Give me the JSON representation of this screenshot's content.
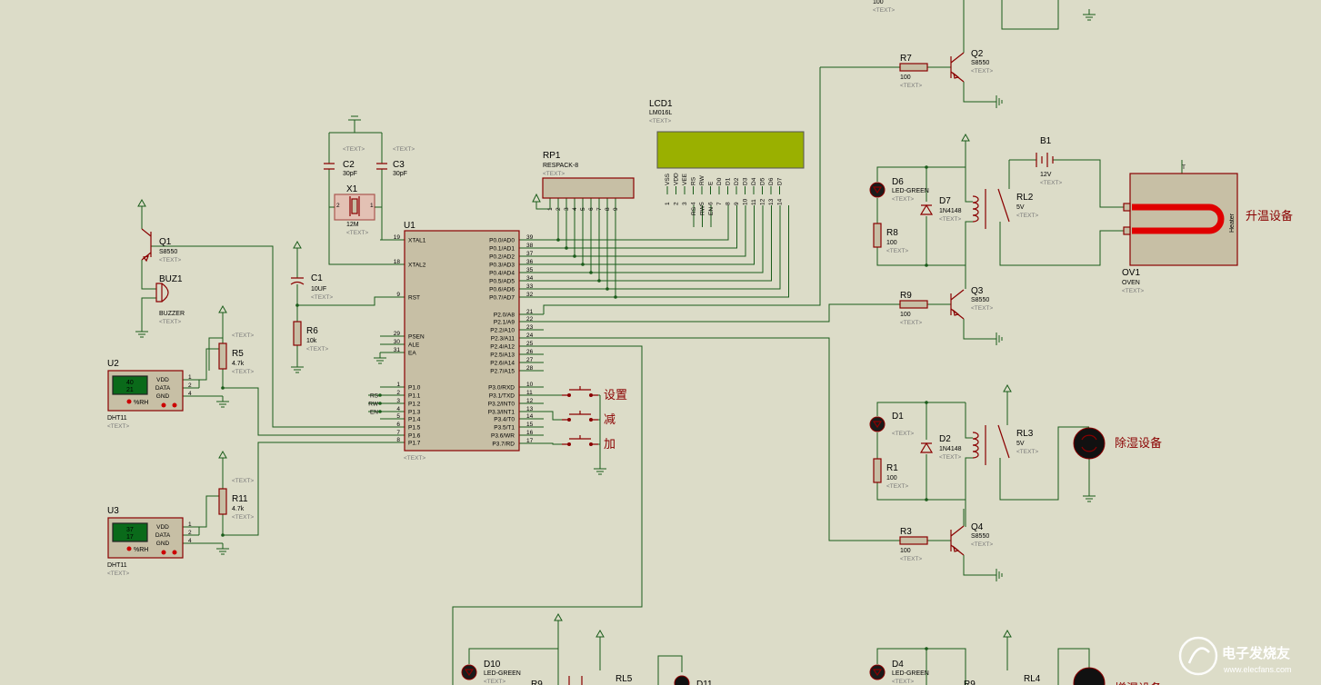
{
  "text_placeholder": "<TEXT>",
  "q1": {
    "ref": "Q1",
    "val": "S8550"
  },
  "buz1": {
    "ref": "BUZ1",
    "val": "BUZZER"
  },
  "q2": {
    "ref": "Q2",
    "val": "S8550"
  },
  "q3": {
    "ref": "Q3",
    "val": "S8550"
  },
  "q4": {
    "ref": "Q4",
    "val": "S8550"
  },
  "r5": {
    "ref": "R5",
    "val": "4.7k"
  },
  "r11": {
    "ref": "R11",
    "val": "4.7k"
  },
  "r6": {
    "ref": "R6",
    "val": "10k"
  },
  "r7": {
    "ref": "R7",
    "val": "100"
  },
  "r9": {
    "ref": "R9",
    "val": "100"
  },
  "r3": {
    "ref": "R3",
    "val": "100"
  },
  "r8": {
    "ref": "R8",
    "val": "100"
  },
  "r1": {
    "ref": "R1",
    "val": "100"
  },
  "r_top": {
    "val": "100"
  },
  "r9b": {
    "ref": "R9"
  },
  "r10b": {
    "ref": "R9"
  },
  "c1": {
    "ref": "C1",
    "val": "10UF"
  },
  "c2": {
    "ref": "C2",
    "val": "30pF"
  },
  "c3": {
    "ref": "C3",
    "val": "30pF"
  },
  "x1": {
    "ref": "X1",
    "val": "12M",
    "pin1": "1",
    "pin2": "2"
  },
  "u1": {
    "ref": "U1"
  },
  "u2": {
    "ref": "U2",
    "val": "DHT11",
    "t": "40",
    "h": "21",
    "unit": "%RH"
  },
  "u3": {
    "ref": "U3",
    "val": "DHT11",
    "t": "37",
    "h": "17",
    "unit": "%RH"
  },
  "dht_pins": {
    "vdd": "VDD",
    "data": "DATA",
    "gnd": "GND",
    "n1": "1",
    "n2": "2",
    "n4": "4"
  },
  "rp1": {
    "ref": "RP1",
    "val": "RESPACK-8",
    "pins": [
      "1",
      "2",
      "3",
      "4",
      "5",
      "6",
      "7",
      "8",
      "9"
    ]
  },
  "lcd": {
    "ref": "LCD1",
    "val": "LM016L",
    "pins": [
      "VSS",
      "VDD",
      "VEE",
      "RS",
      "RW",
      "E",
      "D0",
      "D1",
      "D2",
      "D3",
      "D4",
      "D5",
      "D6",
      "D7"
    ],
    "nums": [
      "1",
      "2",
      "3",
      "4",
      "5",
      "6",
      "7",
      "8",
      "9",
      "10",
      "11",
      "12",
      "13",
      "14"
    ]
  },
  "lcd_sig": [
    "RS",
    "RW",
    "EN"
  ],
  "mcu_left": [
    {
      "n": "19",
      "l": "XTAL1"
    },
    {
      "n": "18",
      "l": "XTAL2"
    },
    {
      "n": "9",
      "l": "RST"
    },
    {
      "n": "29",
      "l": "PSEN"
    },
    {
      "n": "30",
      "l": "ALE"
    },
    {
      "n": "31",
      "l": "EA"
    },
    {
      "n": "1",
      "l": "P1.0"
    },
    {
      "n": "2",
      "l": "P1.1"
    },
    {
      "n": "3",
      "l": "P1.2"
    },
    {
      "n": "4",
      "l": "P1.3"
    },
    {
      "n": "5",
      "l": "P1.4"
    },
    {
      "n": "6",
      "l": "P1.5"
    },
    {
      "n": "7",
      "l": "P1.6"
    },
    {
      "n": "8",
      "l": "P1.7"
    }
  ],
  "mcu_right": [
    {
      "n": "39",
      "l": "P0.0/AD0"
    },
    {
      "n": "38",
      "l": "P0.1/AD1"
    },
    {
      "n": "37",
      "l": "P0.2/AD2"
    },
    {
      "n": "36",
      "l": "P0.3/AD3"
    },
    {
      "n": "35",
      "l": "P0.4/AD4"
    },
    {
      "n": "34",
      "l": "P0.5/AD5"
    },
    {
      "n": "33",
      "l": "P0.6/AD6"
    },
    {
      "n": "32",
      "l": "P0.7/AD7"
    },
    {
      "n": "21",
      "l": "P2.0/A8"
    },
    {
      "n": "22",
      "l": "P2.1/A9"
    },
    {
      "n": "23",
      "l": "P2.2/A10"
    },
    {
      "n": "24",
      "l": "P2.3/A11"
    },
    {
      "n": "25",
      "l": "P2.4/A12"
    },
    {
      "n": "26",
      "l": "P2.5/A13"
    },
    {
      "n": "27",
      "l": "P2.6/A14"
    },
    {
      "n": "28",
      "l": "P2.7/A15"
    },
    {
      "n": "10",
      "l": "P3.0/RXD"
    },
    {
      "n": "11",
      "l": "P3.1/TXD"
    },
    {
      "n": "12",
      "l": "P3.2/INT0"
    },
    {
      "n": "13",
      "l": "P3.3/INT1"
    },
    {
      "n": "14",
      "l": "P3.4/T0"
    },
    {
      "n": "15",
      "l": "P3.5/T1"
    },
    {
      "n": "16",
      "l": "P3.6/WR"
    },
    {
      "n": "17",
      "l": "P3.7/RD"
    }
  ],
  "p1_sig": [
    "RS",
    "RW",
    "EN"
  ],
  "buttons": [
    "设置",
    "减",
    "加"
  ],
  "d6": {
    "ref": "D6",
    "val": "LED-GREEN"
  },
  "d7": {
    "ref": "D7",
    "val": "1N4148"
  },
  "d1": {
    "ref": "D1"
  },
  "d2": {
    "ref": "D2",
    "val": "1N4148"
  },
  "d4": {
    "ref": "D4",
    "val": "LED-GREEN"
  },
  "d10": {
    "ref": "D10",
    "val": "LED-GREEN"
  },
  "d11": {
    "ref": "D11"
  },
  "rl2": {
    "ref": "RL2",
    "val": "5V"
  },
  "rl3": {
    "ref": "RL3",
    "val": "5V"
  },
  "rl4": {
    "ref": "RL4"
  },
  "rl5": {
    "ref": "RL5"
  },
  "b1": {
    "ref": "B1",
    "val": "12V"
  },
  "ov1": {
    "ref": "OV1",
    "val": "OVEN",
    "heater": "Heater",
    "t": "T"
  },
  "heat_label": "升温设备",
  "dehum_label": "除湿设备",
  "hum_label": "增湿设备",
  "watermark": {
    "name": "电子发烧友",
    "url": "www.elecfans.com"
  },
  "colors": {
    "bg": "#dcdcc8",
    "wire": "#1a5c1a",
    "part": "#8a0000",
    "lcd": "#9ab000",
    "heater": "#e00000"
  }
}
